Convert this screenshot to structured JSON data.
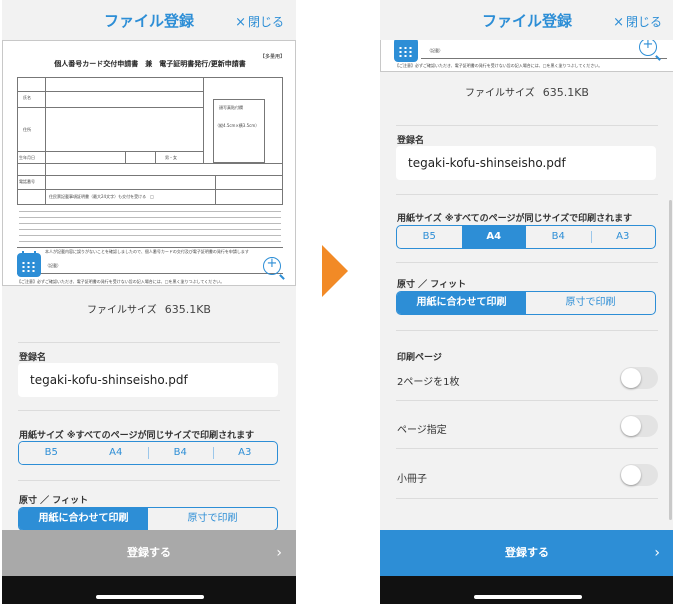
{
  "header": {
    "title": "ファイル登録",
    "close_icon": "×",
    "close_label": "閉じる"
  },
  "document": {
    "badge": "【多量用】",
    "title": "個人番号カード交付申請書　兼　電子証明書発行/更新申請書",
    "top_strip_text": "【ご注意】必ずご確認いただき、電子証明書の発行を受けない旨の記入場合には、□を黒く塗りつぶしてください。",
    "sign_text": "（記載）",
    "field_name": "氏名",
    "field_address": "住所",
    "field_dob": "生年月日",
    "photo_label": "顔写真貼付欄",
    "photo_size": "（縦4.5cm×横3.5cm）",
    "field_gender": "男・女",
    "field_phone": "電話番号",
    "consent": "住民票記載事項証明書（最大24文字）も交付を受ける　□",
    "notice": "本人が記載内容に誤りがないことを確認しましたので、個人番号カードの交付及び電子証明書の発行を申請します"
  },
  "file": {
    "size_label": "ファイルサイズ",
    "size_value": "635.1KB"
  },
  "name_section": {
    "label": "登録名",
    "value": "tegaki-kofu-shinseisho.pdf"
  },
  "paper_size": {
    "label": "用紙サイズ ※すべてのページが同じサイズで印刷されます",
    "options": [
      "B5",
      "A4",
      "B4",
      "A3"
    ],
    "selected_first": "B5",
    "selected_second": "A4"
  },
  "fit": {
    "label": "原寸 ／ フィット",
    "options": [
      "用紙に合わせて印刷",
      "原寸で印刷"
    ],
    "selected": "用紙に合わせて印刷"
  },
  "print_pages": {
    "label": "印刷ページ",
    "rows": [
      {
        "label": "2ページを1枚",
        "on": false
      },
      {
        "label": "ページ指定",
        "on": false
      },
      {
        "label": "小冊子",
        "on": false
      }
    ]
  },
  "register": {
    "label": "登録する",
    "chevron": "›"
  },
  "colors": {
    "accent": "#2d8ed6",
    "disabled": "#a9a9a9",
    "arrow": "#f28a26"
  }
}
